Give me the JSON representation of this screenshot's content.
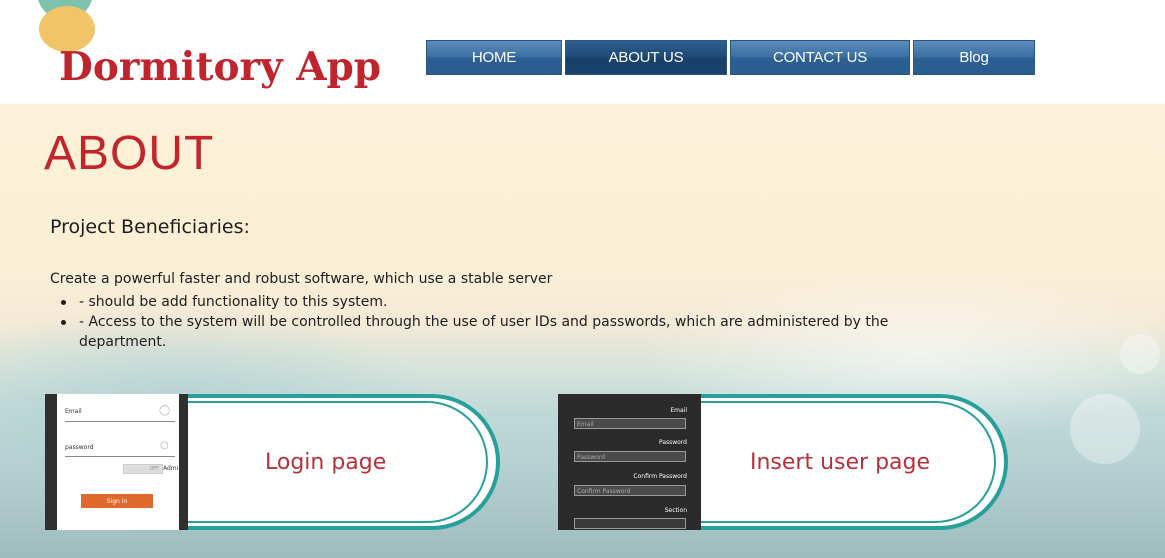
{
  "header": {
    "logo_text": "Dormitory App",
    "nav": [
      {
        "label": "HOME",
        "active": false
      },
      {
        "label": "ABOUT US",
        "active": true
      },
      {
        "label": "CONTACT US",
        "active": false
      },
      {
        "label": "Blog",
        "active": false
      }
    ]
  },
  "main": {
    "heading": "ABOUT",
    "subheading": "Project Beneficiaries:",
    "intro": "Create a powerful faster and robust software, which use a stable server",
    "bullets": [
      "- should be add functionality to this system.",
      "- Access to the system will be controlled through the use of user IDs and passwords, which are administered by the",
      "department."
    ]
  },
  "cards": {
    "login": {
      "label": "Login page",
      "email_label": "Email",
      "password_label": "password",
      "toggle_label": "Admin",
      "toggle_text": "OFF",
      "signin_label": "Sign in"
    },
    "insert": {
      "label": "Insert user page",
      "email_label": "Email",
      "email_placeholder": "Email",
      "password_label": "Password",
      "password_placeholder": "Password",
      "confirm_label": "Confirm Password",
      "confirm_placeholder": "Confirm Password",
      "section_label": "Section"
    }
  },
  "colors": {
    "brand_red": "#c0242c",
    "nav_blue": "#3a6fa4",
    "accent_teal": "#27a09c"
  }
}
